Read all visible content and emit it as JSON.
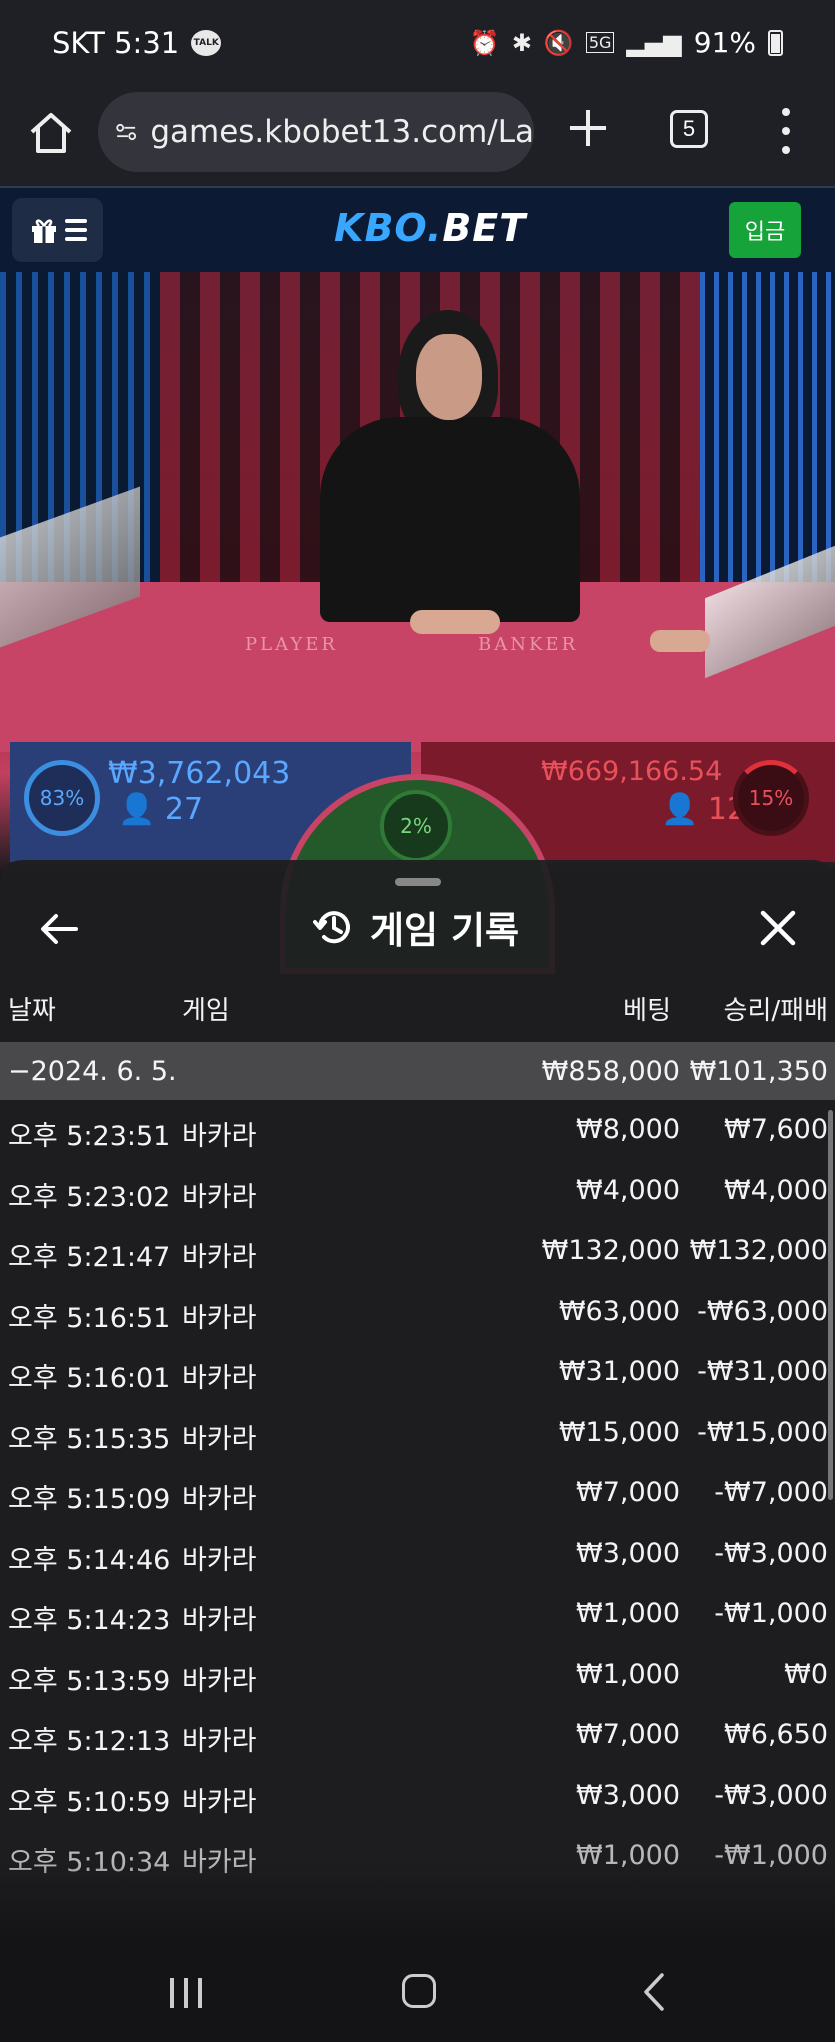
{
  "status_bar": {
    "carrier_time": "SKT 5:31",
    "talk_icon_text": "TALK",
    "battery": "91%",
    "icons": [
      "alarm-icon",
      "bluetooth-icon",
      "mute-icon",
      "5g-icon",
      "signal-icon",
      "battery-icon"
    ]
  },
  "browser": {
    "url": "games.kbobet13.com/La",
    "tab_count": "5"
  },
  "site": {
    "logo_part1": "KBO.",
    "logo_part2": "BET",
    "deposit_label": "입금",
    "colors": {
      "header_bg": "#0d1a33",
      "logo_blue": "#39a7ff",
      "deposit_green": "#16a33a"
    }
  },
  "game": {
    "felt_player": "PLAYER",
    "felt_banker": "BANKER",
    "player_pct": "83%",
    "player_amount": "₩3,762,043",
    "player_count": "27",
    "banker_pct": "15%",
    "banker_amount": "₩669,166.54",
    "banker_count": "12",
    "tie_pct": "2%",
    "colors": {
      "player": "#5aa7ff",
      "banker": "#e8505a",
      "tie": "#7ad67e"
    }
  },
  "history": {
    "title": "게임 기록",
    "columns": {
      "date": "날짜",
      "game": "게임",
      "bet": "베팅",
      "win_loss": "승리/패배"
    },
    "summary": {
      "date": "−2024. 6. 5.",
      "bet": "₩858,000",
      "win_loss": "₩101,350"
    },
    "rows": [
      {
        "time": "오후 5:23:51",
        "game": "바카라",
        "bet": "₩8,000",
        "result": "₩7,600"
      },
      {
        "time": "오후 5:23:02",
        "game": "바카라",
        "bet": "₩4,000",
        "result": "₩4,000"
      },
      {
        "time": "오후 5:21:47",
        "game": "바카라",
        "bet": "₩132,000",
        "result": "₩132,000"
      },
      {
        "time": "오후 5:16:51",
        "game": "바카라",
        "bet": "₩63,000",
        "result": "-₩63,000"
      },
      {
        "time": "오후 5:16:01",
        "game": "바카라",
        "bet": "₩31,000",
        "result": "-₩31,000"
      },
      {
        "time": "오후 5:15:35",
        "game": "바카라",
        "bet": "₩15,000",
        "result": "-₩15,000"
      },
      {
        "time": "오후 5:15:09",
        "game": "바카라",
        "bet": "₩7,000",
        "result": "-₩7,000"
      },
      {
        "time": "오후 5:14:46",
        "game": "바카라",
        "bet": "₩3,000",
        "result": "-₩3,000"
      },
      {
        "time": "오후 5:14:23",
        "game": "바카라",
        "bet": "₩1,000",
        "result": "-₩1,000"
      },
      {
        "time": "오후 5:13:59",
        "game": "바카라",
        "bet": "₩1,000",
        "result": "₩0"
      },
      {
        "time": "오후 5:12:13",
        "game": "바카라",
        "bet": "₩7,000",
        "result": "₩6,650"
      },
      {
        "time": "오후 5:10:59",
        "game": "바카라",
        "bet": "₩3,000",
        "result": "-₩3,000"
      },
      {
        "time": "오후 5:10:34",
        "game": "바카라",
        "bet": "₩1,000",
        "result": "-₩1,000"
      }
    ]
  }
}
